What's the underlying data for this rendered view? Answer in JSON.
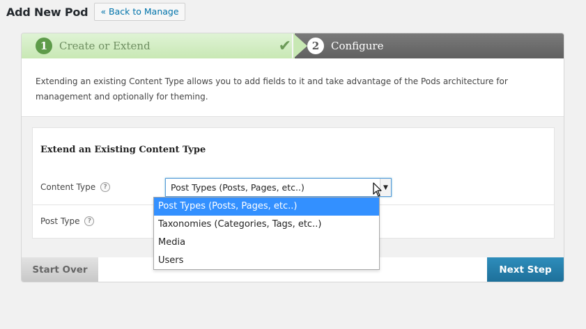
{
  "header": {
    "title": "Add New Pod",
    "back_label": "« Back to Manage"
  },
  "steps": [
    {
      "number": "1",
      "label": "Create or Extend",
      "status": "complete"
    },
    {
      "number": "2",
      "label": "Configure",
      "status": "active"
    }
  ],
  "intro": {
    "text": "Extending an existing Content Type allows you to add fields to it and take advantage of the Pods architecture for management and optionally for theming."
  },
  "form": {
    "title": "Extend an Existing Content Type",
    "content_type": {
      "label": "Content Type",
      "selected": "Post Types (Posts, Pages, etc..)",
      "options": [
        "Post Types (Posts, Pages, etc..)",
        "Taxonomies (Categories, Tags, etc..)",
        "Media",
        "Users"
      ]
    },
    "post_type": {
      "label": "Post Type"
    }
  },
  "footer": {
    "start_over": "Start Over",
    "next_step": "Next Step"
  },
  "colors": {
    "accent": "#1d6f99",
    "step_complete": "#c8e8b4",
    "step_active": "#606060",
    "selected_option": "#3390ff"
  }
}
